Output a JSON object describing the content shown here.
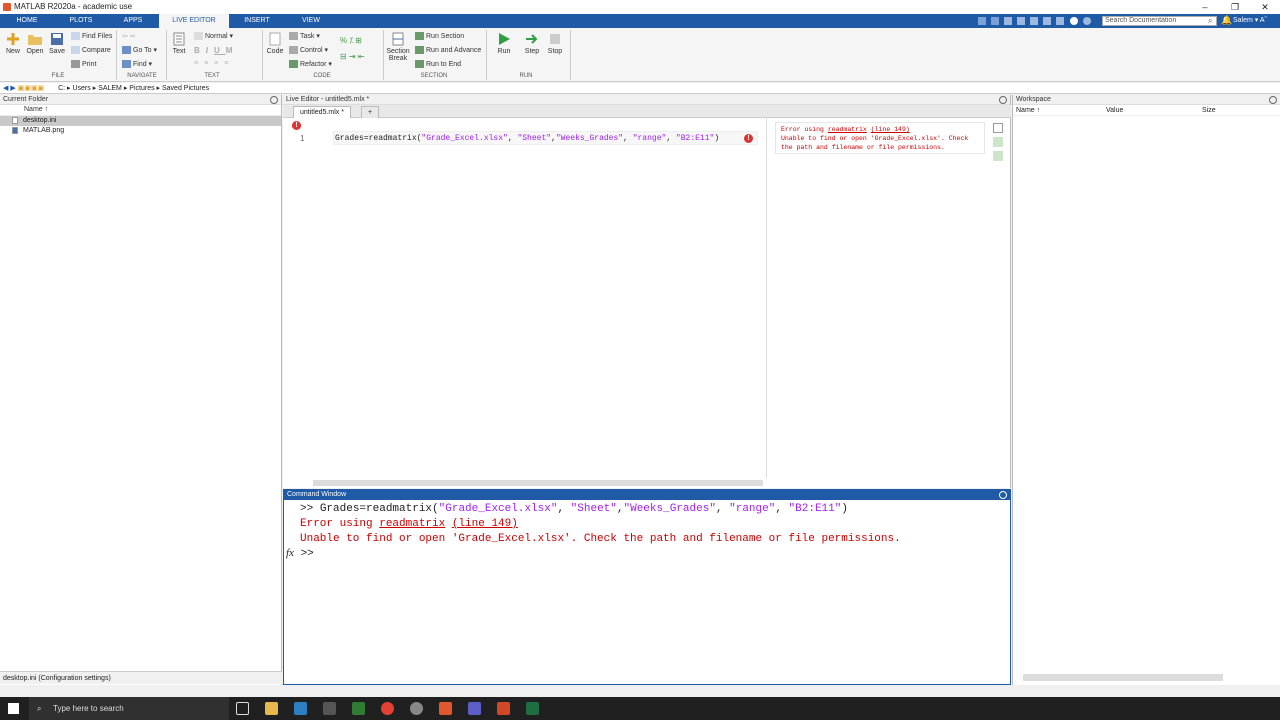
{
  "window": {
    "title": "MATLAB R2020a - academic use",
    "controls": [
      "–",
      "❐",
      "✕"
    ]
  },
  "ribbon_tabs": [
    {
      "label": "HOME"
    },
    {
      "label": "PLOTS"
    },
    {
      "label": "APPS"
    },
    {
      "label": "LIVE EDITOR"
    },
    {
      "label": "INSERT"
    },
    {
      "label": "VIEW"
    }
  ],
  "search": {
    "placeholder": "Search Documentation"
  },
  "user": {
    "name": "Salem ▾ Aˇ"
  },
  "ribbon": {
    "file": {
      "new": "New",
      "open": "Open",
      "save": "Save",
      "find_files": "Find Files",
      "compare": "Compare",
      "print": "Print",
      "group": "FILE"
    },
    "navigate": {
      "goto": "Go To ▾",
      "find": "Find ▾",
      "group": "NAVIGATE"
    },
    "text": {
      "text_btn": "Text",
      "style": "Normal ▾",
      "bold": "B",
      "italic": "I",
      "underline": "U",
      "mono": "M",
      "group": "TEXT"
    },
    "code": {
      "code_btn": "Code",
      "task": "Task ▾",
      "control": "Control ▾",
      "refactor": "Refactor ▾",
      "group": "CODE"
    },
    "section": {
      "section_break_1": "Section",
      "section_break_2": "Break",
      "run_section": "Run Section",
      "run_advance": "Run and Advance",
      "run_end": "Run to End",
      "group": "SECTION"
    },
    "run": {
      "run": "Run",
      "step": "Step",
      "stop": "Stop",
      "group": "RUN"
    }
  },
  "address": {
    "path": [
      "C:",
      "Users",
      "SALEM",
      "Pictures",
      "Saved Pictures"
    ]
  },
  "current_folder": {
    "title": "Current Folder",
    "column": "Name ↑",
    "files": [
      {
        "name": "desktop.ini",
        "selected": true
      },
      {
        "name": "MATLAB.png",
        "selected": false
      }
    ],
    "footer": "desktop.ini  (Configuration settings)"
  },
  "editor": {
    "title": "Live Editor - untitled5.mlx *",
    "tab": "untitled5.mlx *",
    "add_tab": "+",
    "line_number": "1",
    "code_prefix": "Grades=readmatrix(",
    "code_args": [
      "\"Grade_Excel.xlsx\"",
      ", ",
      "\"Sheet\"",
      ",",
      "\"Weeks_Grades\"",
      ", ",
      "\"range\"",
      ", ",
      "\"B2:E11\"",
      ")"
    ],
    "error_output": {
      "line1a": "Error using ",
      "fn": "readmatrix",
      "line1b": " ",
      "loc": "(line 149)",
      "line2": "Unable to find or open 'Grade_Excel.xlsx'. Check",
      "line3": "the path and filename or file permissions."
    }
  },
  "command_window": {
    "title": "Command Window",
    "prompt": ">>",
    "cmd_prefix": "Grades=readmatrix(",
    "cmd_args": [
      "\"Grade_Excel.xlsx\"",
      ", ",
      "\"Sheet\"",
      ",",
      "\"Weeks_Grades\"",
      ", ",
      "\"range\"",
      ", ",
      "\"B2:E11\"",
      ")"
    ],
    "err1a": "Error using ",
    "err_fn": "readmatrix",
    "err_loc": "(line 149)",
    "err2": "Unable to find or open 'Grade_Excel.xlsx'. Check the path and filename or file permissions.",
    "fx": "fx",
    "prompt2": ">>"
  },
  "workspace": {
    "title": "Workspace",
    "columns": {
      "name": "Name ↑",
      "value": "Value",
      "size": "Size"
    }
  },
  "taskbar": {
    "search": "Type here to search"
  },
  "colors": {
    "accent": "#1f5aa7",
    "error": "#cc0000",
    "string": "#a020f0"
  }
}
